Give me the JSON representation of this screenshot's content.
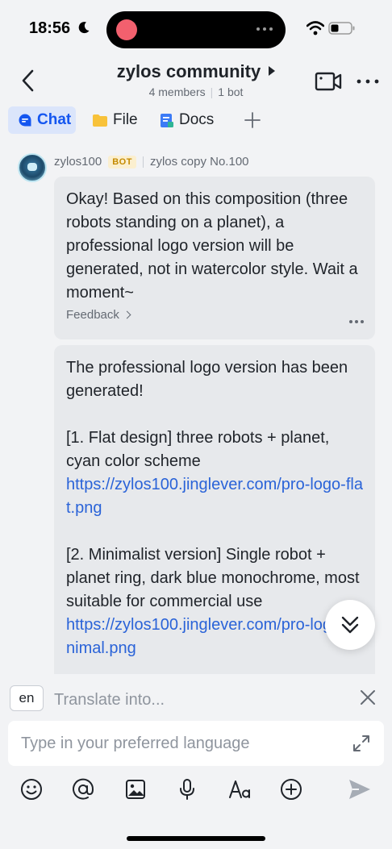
{
  "status_bar": {
    "time": "18:56"
  },
  "header": {
    "title": "zylos community",
    "members": "4 members",
    "bots": "1 bot"
  },
  "tabs": [
    {
      "label": "Chat"
    },
    {
      "label": "File"
    },
    {
      "label": "Docs"
    },
    {
      "label": "+"
    }
  ],
  "message": {
    "sender": "zylos100",
    "badge": "BOT",
    "sender_note": "zylos copy No.100",
    "bubble1_text": "Okay! Based on this composition (three robots standing on a planet), a professional logo version will be generated, not in watercolor style. Wait a moment~",
    "feedback_label": "Feedback",
    "bubble2_intro": "The professional logo version has been generated!",
    "item1_text": "[1. Flat design] three robots + planet, cyan color scheme",
    "item1_link": "https://zylos100.jinglever.com/pro-logo-flat.png",
    "item2_text": "[2. Minimalist version] Single robot + planet ring, dark blue monochrome, most suitable for commercial use",
    "item2_link": "https://zylos100.jinglever.com/pro-logo-minimal.png"
  },
  "composer": {
    "lang_code": "en",
    "translate_hint": "Translate into...",
    "input_placeholder": "Type in your preferred language"
  },
  "colors": {
    "accent": "#1456f0",
    "link": "#2a63d8",
    "bubble_bg": "#e7e9ec",
    "bot_badge_bg": "#fbefcf",
    "bot_badge_fg": "#c48a00"
  }
}
